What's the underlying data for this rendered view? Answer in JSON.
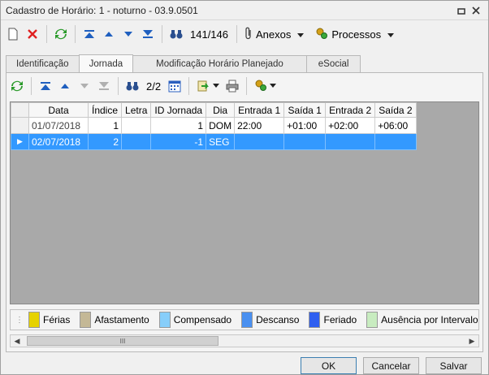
{
  "window": {
    "title": "Cadastro de Horário: 1 - noturno - 03.9.0501",
    "controls": [
      "restore-icon",
      "close-icon"
    ]
  },
  "toolbar": {
    "record_counter": "141/146",
    "anexos_label": "Anexos",
    "processos_label": "Processos"
  },
  "tabs": [
    {
      "label": "Identificação",
      "active": false
    },
    {
      "label": "Jornada",
      "active": true
    },
    {
      "label": "Modificação Horário Planejado",
      "active": false
    },
    {
      "label": "eSocial",
      "active": false
    }
  ],
  "subtoolbar": {
    "record_counter": "2/2"
  },
  "grid": {
    "columns": [
      "Data",
      "Índice",
      "Letra",
      "ID Jornada",
      "Dia",
      "Entrada 1",
      "Saída 1",
      "Entrada 2",
      "Saída 2"
    ],
    "rows": [
      {
        "data": "01/07/2018",
        "indice": "1",
        "letra": "",
        "id_jornada": "1",
        "dia": "DOM",
        "entrada1": "22:00",
        "saida1": "+01:00",
        "entrada2": "+02:00",
        "saida2": "+06:00",
        "selected": false
      },
      {
        "data": "02/07/2018",
        "indice": "2",
        "letra": "",
        "id_jornada": "-1",
        "dia": "SEG",
        "entrada1": "",
        "saida1": "",
        "entrada2": "",
        "saida2": "",
        "selected": true
      }
    ],
    "row_pointer": "▶"
  },
  "legend": [
    {
      "label": "Férias",
      "color": "#e6d200"
    },
    {
      "label": "Afastamento",
      "color": "#c4b896"
    },
    {
      "label": "Compensado",
      "color": "#87cefa"
    },
    {
      "label": "Descanso",
      "color": "#4a90f0"
    },
    {
      "label": "Feriado",
      "color": "#2f5ff0"
    },
    {
      "label": "Ausência por Intervalo",
      "color": "#c8ecc0"
    },
    {
      "label": "",
      "color": "#90e080"
    }
  ],
  "scrollbar": {
    "thumb_label": "III"
  },
  "footer": {
    "ok_label": "OK",
    "cancel_label": "Cancelar",
    "save_label": "Salvar"
  },
  "colors": {
    "selection": "#3399ff",
    "grid_background": "#a9a9a9"
  }
}
